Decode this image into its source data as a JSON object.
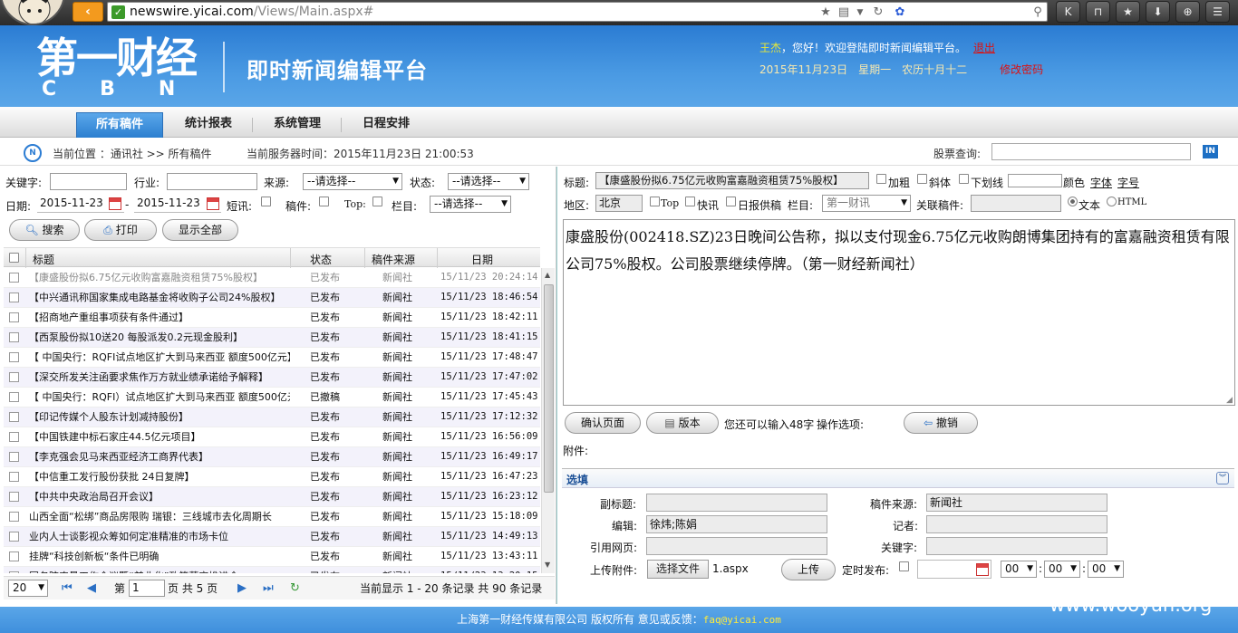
{
  "browser": {
    "host": "newswire.yicai.com",
    "path": "/Views/Main.aspx#"
  },
  "header": {
    "logo_cn": "第一财经",
    "logo_en": "CBN",
    "platform_title": "即时新闻编辑平台",
    "user": "王杰",
    "welcome": "，您好！欢迎登陆即时新闻编辑平台。",
    "logout": "退出",
    "date": "2015年11月23日　星期一　农历十月十二",
    "change_password": "修改密码"
  },
  "nav": {
    "tabs": [
      "所有稿件",
      "统计报表",
      "系统管理",
      "日程安排"
    ]
  },
  "crumb": {
    "label": "当前位置 ：通讯社 >> 所有稿件",
    "server_time": "当前服务器时间：2015年11月23日 21:00:53",
    "stock_label": "股票查询:",
    "in_icon": "IN"
  },
  "filters": {
    "keyword_label": "关键字:",
    "industry_label": "行业:",
    "source_label": "来源:",
    "source_value": "--请选择--",
    "status_label": "状态:",
    "status_value": "--请选择--",
    "date_label": "日期:",
    "date_from": "2015-11-23",
    "date_to": "2015-11-23",
    "dash": "-",
    "flash_label": "短讯:",
    "draft_label": "稿件:",
    "top_label": "Top:",
    "column_label": "栏目:",
    "column_value": "--请选择--",
    "search": "搜索",
    "print": "打印",
    "show_all": "显示全部"
  },
  "grid": {
    "headers": [
      "标题",
      "状态",
      "稿件来源",
      "日期"
    ],
    "rows": [
      [
        "【康盛股份拟6.75亿元收购富嘉融资租赁75%股权】",
        "已发布",
        "新闻社",
        "15/11/23 20:24:14"
      ],
      [
        "【中兴通讯称国家集成电路基金将收购子公司24%股权】",
        "已发布",
        "新闻社",
        "15/11/23 18:46:54"
      ],
      [
        "【招商地产重组事项获有条件通过】",
        "已发布",
        "新闻社",
        "15/11/23 18:42:11"
      ],
      [
        "【西泵股份拟10送20 每股派发0.2元现金股利】",
        "已发布",
        "新闻社",
        "15/11/23 18:41:15"
      ],
      [
        "【 中国央行：RQFI试点地区扩大到马来西亚 额度500亿元】",
        "已发布",
        "新闻社",
        "15/11/23 17:48:47"
      ],
      [
        "【深交所发关注函要求焦作万方就业绩承诺给予解释】",
        "已发布",
        "新闻社",
        "15/11/23 17:47:02"
      ],
      [
        "【 中国央行：RQFI）试点地区扩大到马来西亚 额度500亿元】",
        "已撤稿",
        "新闻社",
        "15/11/23 17:45:43"
      ],
      [
        "【印记传媒个人股东计划减持股份】",
        "已发布",
        "新闻社",
        "15/11/23 17:12:32"
      ],
      [
        "【中国铁建中标石家庄44.5亿元项目】",
        "已发布",
        "新闻社",
        "15/11/23 16:56:09"
      ],
      [
        "【李克强会见马来西亚经济工商界代表】",
        "已发布",
        "新闻社",
        "15/11/23 16:49:17"
      ],
      [
        "【中信重工发行股份获批 24日复牌】",
        "已发布",
        "新闻社",
        "15/11/23 16:47:23"
      ],
      [
        "【中共中央政治局召开会议】",
        "已发布",
        "新闻社",
        "15/11/23 16:23:12"
      ],
      [
        "山西全面“松绑”商品房限购 瑞银：三线城市去化周期长",
        "已发布",
        "新闻社",
        "15/11/23 15:18:09"
      ],
      [
        "业内人士谈影视众筹如何定准精准的市场卡位",
        "已发布",
        "新闻社",
        "15/11/23 14:49:13"
      ],
      [
        "挂牌“科技创新板“条件已明确",
        "已发布",
        "新闻社",
        "15/11/23 13:43:11"
      ],
      [
        "国务院农垦工作会议暨“兼业化”政策落实推进会",
        "已发布",
        "新闻社",
        "15/11/23 13:20:15"
      ]
    ]
  },
  "pager": {
    "page_size": "20",
    "page_prefix": "第",
    "page": "1",
    "page_suffix": "页 共 5 页",
    "summary": "当前显示 1 - 20 条记录 共 90 条记录"
  },
  "editor": {
    "title_label": "标题:",
    "title_value": "【康盛股份拟6.75亿元收购富嘉融资租赁75%股权】",
    "bold": "加粗",
    "italic": "斜体",
    "underline": "下划线",
    "color": "颜色",
    "font": "字体",
    "size": "字号",
    "region_label": "地区:",
    "region_value": "北京",
    "top": "Top",
    "flash": "快讯",
    "daily": "日报供稿",
    "column_label": "栏目:",
    "column_value": "第一财讯",
    "related_label": "关联稿件:",
    "text_mode": "文本",
    "html_mode": "HTML",
    "content": "康盛股份(002418.SZ)23日晚间公告称，拟以支付现金6.75亿元收购朗博集团持有的富嘉融资租赁有限公司75%股权。公司股票继续停牌。（第一财经新闻社）",
    "confirm": "确认页面",
    "version": "版本",
    "remaining": "您还可以输入48字",
    "ops_label": "操作选项:",
    "revoke": "撤销",
    "attachment_label": "附件:"
  },
  "options": {
    "title": "选填",
    "subtitle_label": "副标题:",
    "source_label": "稿件来源:",
    "source_value": "新闻社",
    "editor_label": "编辑:",
    "editor_value": "徐炜;陈娟",
    "reporter_label": "记者:",
    "ref_label": "引用网页:",
    "keyword_label": "关键字:",
    "upload_label": "上传附件:",
    "choose_file": "选择文件",
    "file_name": "1.aspx",
    "upload": "上传",
    "schedule_label": "定时发布:",
    "hour": "00",
    "minute": "00",
    "second": "00",
    "colon": ":"
  },
  "footer": {
    "text": "上海第一财经传媒有限公司 版权所有 意见或反馈：",
    "email": "faq@yicai.com"
  },
  "watermark": "www.wooyun.org"
}
